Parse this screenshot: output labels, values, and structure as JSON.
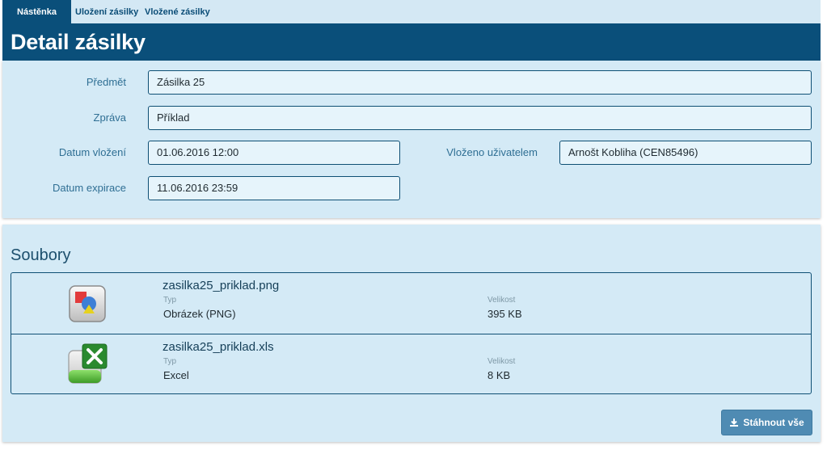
{
  "tabs": [
    {
      "label": "Nástěnka",
      "active": true
    },
    {
      "label": "Uložení zásilky",
      "active": false
    },
    {
      "label": "Vložené zásilky",
      "active": false
    }
  ],
  "header": {
    "title": "Detail zásilky"
  },
  "detail": {
    "subject_label": "Předmět",
    "subject_value": "Zásilka 25",
    "message_label": "Zpráva",
    "message_value": "Příklad",
    "inserted_label": "Datum vložení",
    "inserted_value": "01.06.2016 12:00",
    "user_label": "Vloženo uživatelem",
    "user_value": "Arnošt Kobliha (CEN85496)",
    "expiry_label": "Datum expirace",
    "expiry_value": "11.06.2016 23:59"
  },
  "files": {
    "title": "Soubory",
    "type_label": "Typ",
    "size_label": "Velikost",
    "items": [
      {
        "name": "zasilka25_priklad.png",
        "type": "Obrázek (PNG)",
        "size": "395 KB",
        "icon": "image-file-icon"
      },
      {
        "name": "zasilka25_priklad.xls",
        "type": "Excel",
        "size": "8 KB",
        "icon": "excel-file-icon"
      }
    ],
    "download_all_label": "Stáhnout vše"
  },
  "colors": {
    "brand": "#0a4f7a",
    "panel": "#d4eaf6",
    "button": "#4f8bb3"
  }
}
